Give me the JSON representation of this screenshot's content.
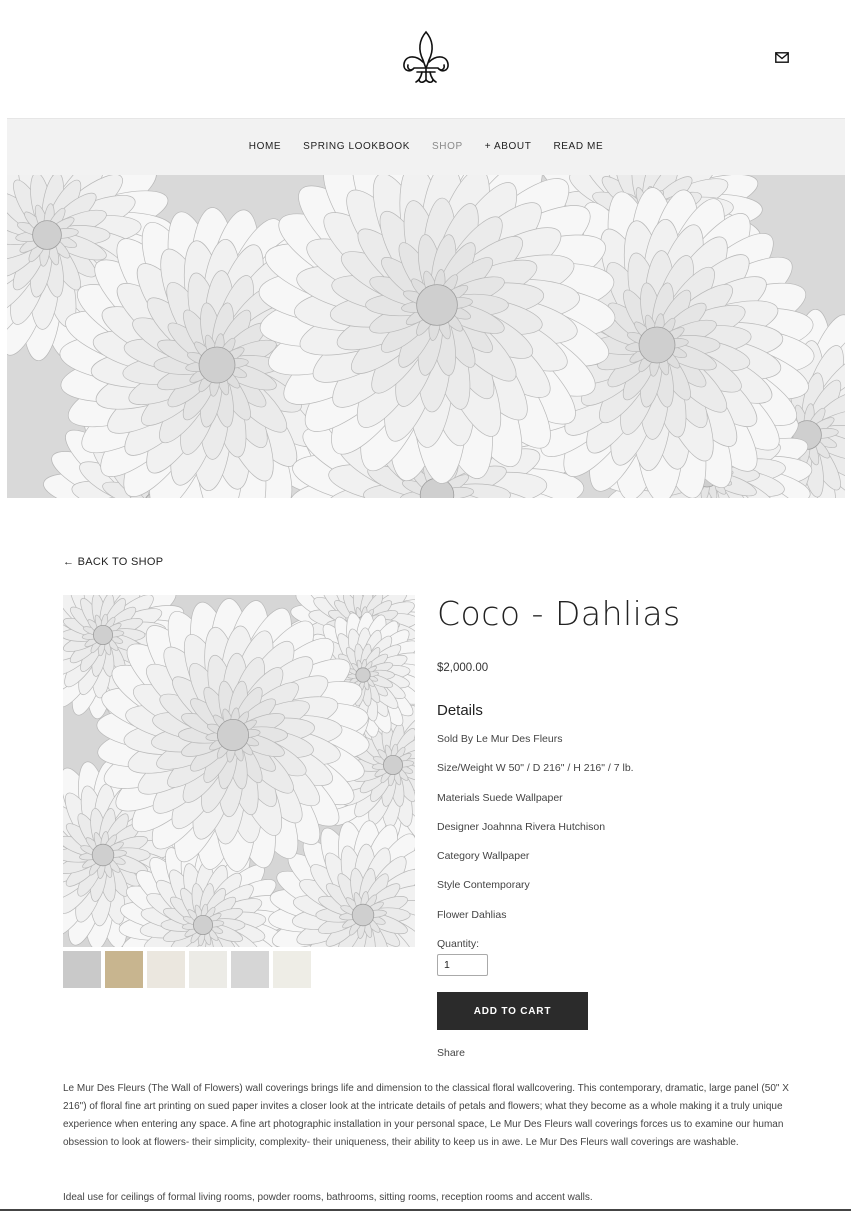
{
  "nav": {
    "items": [
      {
        "label": "HOME",
        "active": false
      },
      {
        "label": "SPRING LOOKBOOK",
        "active": false
      },
      {
        "label": "SHOP",
        "active": true
      },
      {
        "label": "+ ABOUT",
        "active": false
      },
      {
        "label": "READ ME",
        "active": false
      }
    ]
  },
  "product": {
    "back_label": "← BACK TO SHOP",
    "title": "Coco - Dahlias",
    "price": "$2,000.00",
    "details_heading": "Details",
    "details": [
      "Sold By Le Mur Des Fleurs",
      "Size/Weight W 50\" / D 216\" / H 216\" / 7 lb.",
      "Materials Suede Wallpaper",
      "Designer Joahnna Rivera Hutchison",
      "Category Wallpaper",
      "Style Contemporary",
      "Flower Dahlias"
    ],
    "quantity_label": "Quantity:",
    "quantity_value": "1",
    "add_to_cart_label": "ADD TO CART",
    "share_label": "Share",
    "thumbnails": [
      {
        "color": "#c9c9c9"
      },
      {
        "color": "#c8b58f"
      },
      {
        "color": "#ebe7df"
      },
      {
        "color": "#ecebe6"
      },
      {
        "color": "#d6d6d6"
      },
      {
        "color": "#eeede6"
      }
    ],
    "description": "Le Mur Des Fleurs (The Wall of Flowers) wall coverings brings life and dimension to the classical floral wallcovering. This contemporary, dramatic, large panel (50\" X 216\") of floral fine art printing on sued paper invites a closer look at the intricate details of petals and flowers; what they become as a whole making it a truly unique experience when entering any space. A fine art photographic installation in your personal space, Le Mur Des Fleurs wall coverings forces us to examine our human obsession to look at flowers- their simplicity, complexity- their uniqueness, their ability to keep us in awe. Le Mur Des Fleurs wall coverings are washable.",
    "ideal_use": "Ideal use for ceilings of formal living rooms, powder rooms, bathrooms, sitting rooms, reception rooms and accent walls."
  },
  "icons": {
    "logo": "fleur-de-lis-icon",
    "mail": "mail-icon"
  }
}
